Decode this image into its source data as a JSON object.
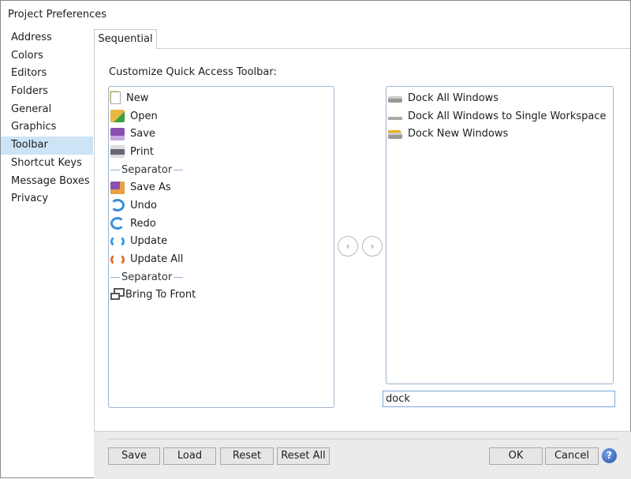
{
  "window": {
    "title": "Project Preferences"
  },
  "sidebar": {
    "items": [
      {
        "label": "Address"
      },
      {
        "label": "Colors"
      },
      {
        "label": "Editors"
      },
      {
        "label": "Folders"
      },
      {
        "label": "General"
      },
      {
        "label": "Graphics"
      },
      {
        "label": "Toolbar",
        "selected": true
      },
      {
        "label": "Shortcut Keys"
      },
      {
        "label": "Message Boxes"
      },
      {
        "label": "Privacy"
      }
    ]
  },
  "tabs": [
    {
      "label": "Sequential",
      "active": true
    }
  ],
  "main": {
    "heading": "Customize Quick Access Toolbar:",
    "toolbar_items": [
      {
        "label": "New",
        "icon": "new-document-icon"
      },
      {
        "label": "Open",
        "icon": "open-folder-icon"
      },
      {
        "label": "Save",
        "icon": "save-disk-icon"
      },
      {
        "label": "Print",
        "icon": "printer-icon"
      },
      {
        "label": "Separator",
        "separator": true
      },
      {
        "label": "Save As",
        "icon": "save-as-icon"
      },
      {
        "label": "Undo",
        "icon": "undo-icon"
      },
      {
        "label": "Redo",
        "icon": "redo-icon"
      },
      {
        "label": "Update",
        "icon": "update-icon"
      },
      {
        "label": "Update All",
        "icon": "update-all-icon"
      },
      {
        "label": "Separator",
        "separator": true
      },
      {
        "label": "Bring To Front",
        "icon": "bring-to-front-icon"
      }
    ],
    "available_items": [
      {
        "label": "Dock All Windows",
        "icon": "dock-all-icon"
      },
      {
        "label": "Dock All Windows to Single Workspace",
        "icon": "dock-single-icon"
      },
      {
        "label": "Dock New Windows",
        "icon": "dock-new-icon"
      }
    ],
    "search_value": "dock",
    "move_left": "‹",
    "move_right": "›"
  },
  "footer": {
    "save": "Save",
    "load": "Load",
    "reset": "Reset",
    "reset_all": "Reset All",
    "ok": "OK",
    "cancel": "Cancel",
    "help": "?"
  }
}
